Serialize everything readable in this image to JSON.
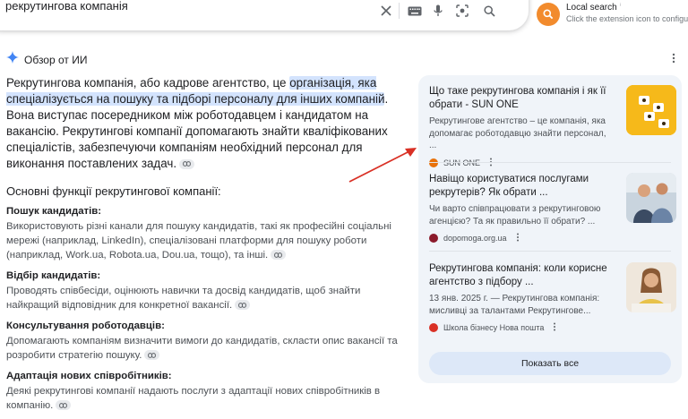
{
  "search": {
    "query": "рекрутингова компанія"
  },
  "extension": {
    "title": "Local search",
    "subtitle": "Click the extension icon to configure",
    "icon": "search-icon"
  },
  "ai_overview": {
    "title": "Обзор от ИИ",
    "intro_before": "Рекрутингова компанія, або кадрове агентство, це ",
    "intro_highlight": "організація, яка спеціалізується на пошуку та підборі персоналу для інших компаній",
    "intro_after": ". Вона виступає посередником між роботодавцем і кандидатом на вакансію. Рекрутингові компанії допомагають знайти кваліфікованих спеціалістів, забезпечуючи компаніям необхідний персонал для виконання поставлених задач.",
    "functions_heading": "Основні функції рекрутингової компанії:",
    "sections": [
      {
        "title": "Пошук кандидатів:",
        "body": "Використовують різні канали для пошуку кандидатів, такі як професійні соціальні мережі (наприклад, LinkedIn), спеціалізовані платформи для пошуку роботи (наприклад, Work.ua, Robota.ua, Dou.ua, тощо), та інші."
      },
      {
        "title": "Відбір кандидатів:",
        "body": "Проводять співбесіди, оцінюють навички та досвід кандидатів, щоб знайти найкращий відповідник для конкретної вакансії."
      },
      {
        "title": "Консультування роботодавців:",
        "body": "Допомагають компаніям визначити вимоги до кандидатів, скласти опис вакансії та розробити стратегію пошуку."
      },
      {
        "title": "Адаптація нових співробітників:",
        "body": "Деякі рекрутингові компанії надають послуги з адаптації нових співробітників в компанію."
      }
    ]
  },
  "sources": [
    {
      "title": "Що таке рекрутингова компанія і як її обрати - SUN ONE",
      "snippet": "Рекрутингове агентство – це компанія, яка допомагає роботодавцю знайти персонал, ...",
      "site": "SUN ONE",
      "favicon_color": "#e8710a"
    },
    {
      "title": "Навіщо користуватися послугами рекрутерів? Як обрати ...",
      "snippet": "Чи варто співпрацювати з рекрутинговою агенцією? Та як правильно її обрати? ...",
      "site": "dopomoga.org.ua",
      "favicon_color": "#8b1a2b"
    },
    {
      "title": "Рекрутингова компанія: коли корисне агентство з підбору ...",
      "snippet": "13 янв. 2025 г. — Рекрутингова компанія: мисливці за талантами Рекрутингове...",
      "site": "Школа бізнесу Нова пошта",
      "favicon_color": "#d93025"
    }
  ],
  "show_all_label": "Показать все",
  "colors": {
    "accent": "#1a73e8",
    "highlight": "#d3e3fd",
    "card_bg": "#f0f4f9",
    "arrow": "#d93025"
  }
}
